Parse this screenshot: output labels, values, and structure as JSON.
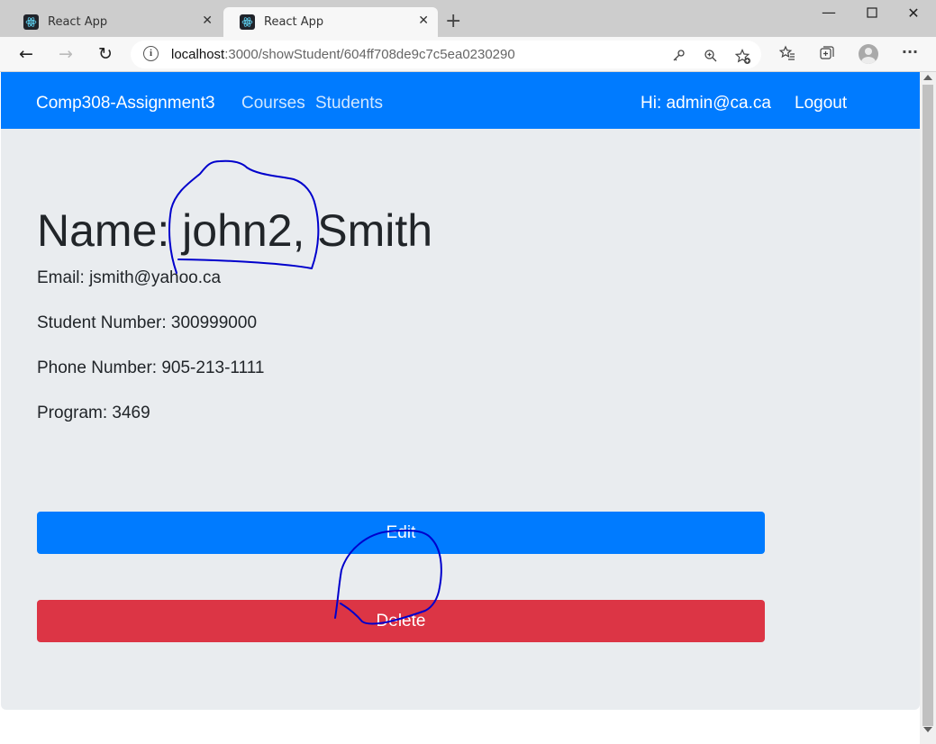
{
  "browser": {
    "tabs": [
      {
        "title": "React App",
        "active": false
      },
      {
        "title": "React App",
        "active": true
      }
    ],
    "new_tab": "+",
    "address": {
      "host": "localhost",
      "path": ":3000/showStudent/604ff708de9c7c5ea0230290"
    },
    "icons": [
      "back-icon",
      "forward-icon",
      "refresh-icon",
      "info-icon",
      "key-icon",
      "zoom-icon",
      "favorite-add-icon",
      "favorites-icon",
      "collections-icon",
      "profile-icon",
      "more-icon"
    ]
  },
  "navbar": {
    "brand": "Comp308-Assignment3",
    "links": [
      "Courses",
      "Students"
    ],
    "greeting": "Hi: admin@ca.ca",
    "logout": "Logout",
    "color": "#007bff"
  },
  "student": {
    "heading": "Name: john2, Smith",
    "email": "Email: jsmith@yahoo.ca",
    "student_number": "Student Number: 300999000",
    "phone": "Phone Number: 905-213-1111",
    "program": "Program: 3469"
  },
  "actions": {
    "edit": "Edit",
    "delete": "Delete",
    "edit_color": "#007bff",
    "delete_color": "#dc3545"
  },
  "annotation_color": "#0000cc"
}
